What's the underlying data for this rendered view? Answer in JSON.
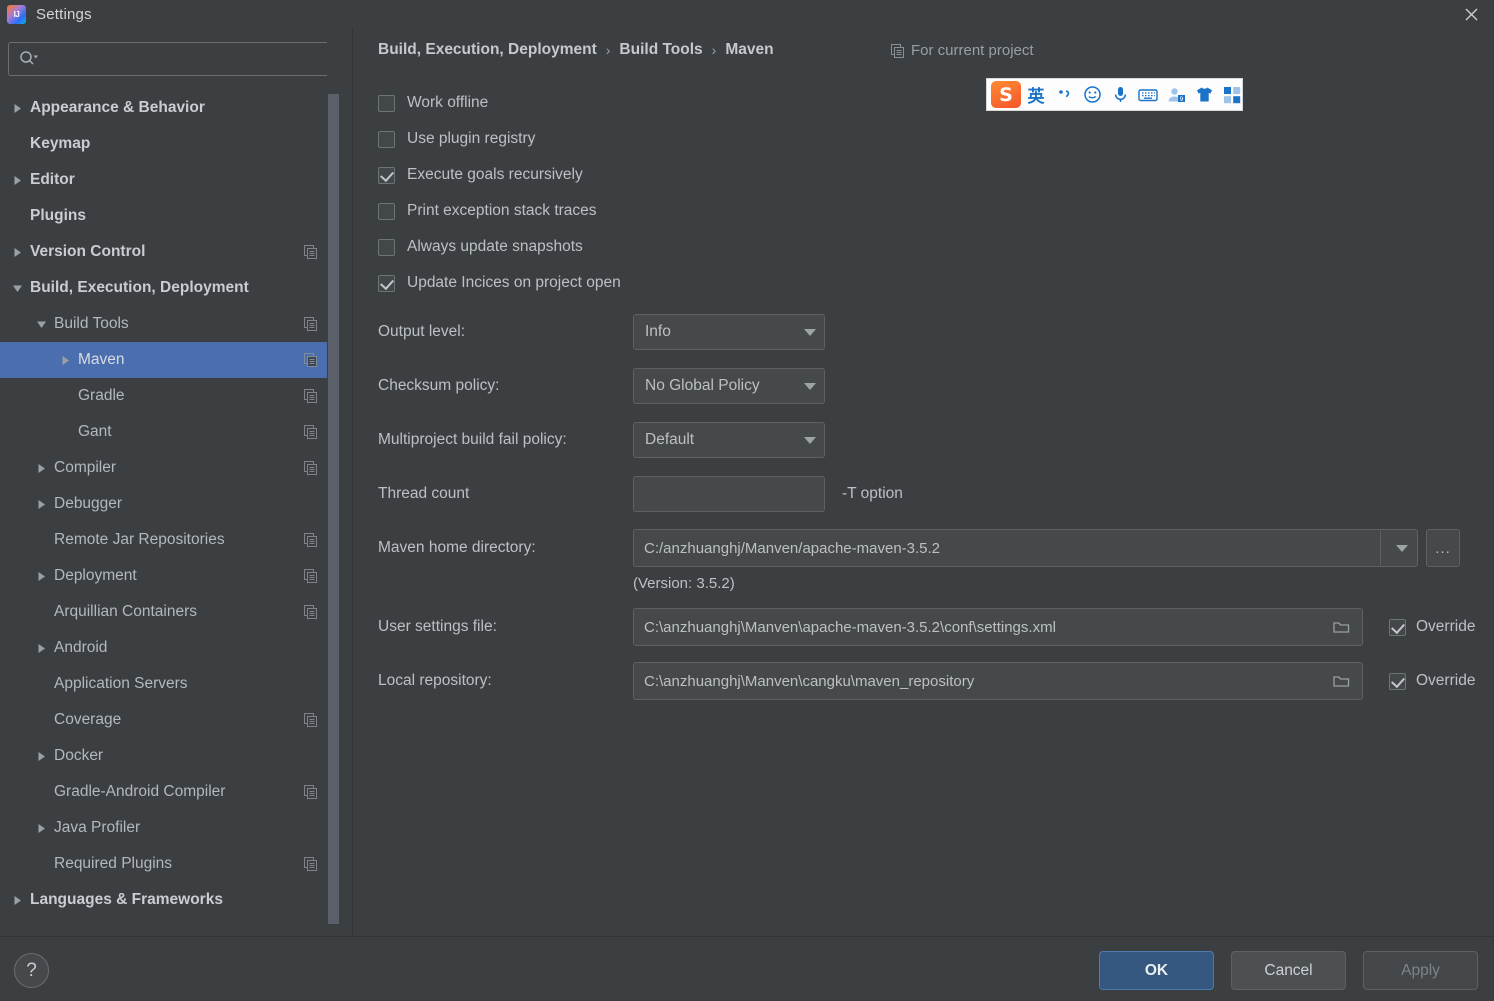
{
  "window": {
    "title": "Settings",
    "app_icon": "intellij-idea-logo",
    "close_icon": "close-icon"
  },
  "sidebar": {
    "search": {
      "placeholder": "",
      "value": "",
      "icon": "search-icon"
    },
    "items": [
      {
        "label": "Appearance & Behavior",
        "indent": 0,
        "arrow": "collapsed",
        "bold": true,
        "copy_icon": false
      },
      {
        "label": "Keymap",
        "indent": 0,
        "arrow": "none",
        "bold": true,
        "copy_icon": false
      },
      {
        "label": "Editor",
        "indent": 0,
        "arrow": "collapsed",
        "bold": true,
        "copy_icon": false
      },
      {
        "label": "Plugins",
        "indent": 0,
        "arrow": "none",
        "bold": true,
        "copy_icon": false
      },
      {
        "label": "Version Control",
        "indent": 0,
        "arrow": "collapsed",
        "bold": true,
        "copy_icon": true
      },
      {
        "label": "Build, Execution, Deployment",
        "indent": 0,
        "arrow": "expanded",
        "bold": true,
        "copy_icon": false
      },
      {
        "label": "Build Tools",
        "indent": 1,
        "arrow": "expanded",
        "bold": false,
        "copy_icon": true
      },
      {
        "label": "Maven",
        "indent": 2,
        "arrow": "collapsed",
        "bold": false,
        "copy_icon": true,
        "selected": true
      },
      {
        "label": "Gradle",
        "indent": 2,
        "arrow": "none",
        "bold": false,
        "copy_icon": true
      },
      {
        "label": "Gant",
        "indent": 2,
        "arrow": "none",
        "bold": false,
        "copy_icon": true
      },
      {
        "label": "Compiler",
        "indent": 1,
        "arrow": "collapsed",
        "bold": false,
        "copy_icon": true
      },
      {
        "label": "Debugger",
        "indent": 1,
        "arrow": "collapsed",
        "bold": false,
        "copy_icon": false
      },
      {
        "label": "Remote Jar Repositories",
        "indent": 1,
        "arrow": "none",
        "bold": false,
        "copy_icon": true
      },
      {
        "label": "Deployment",
        "indent": 1,
        "arrow": "collapsed",
        "bold": false,
        "copy_icon": true
      },
      {
        "label": "Arquillian Containers",
        "indent": 1,
        "arrow": "none",
        "bold": false,
        "copy_icon": true
      },
      {
        "label": "Android",
        "indent": 1,
        "arrow": "collapsed",
        "bold": false,
        "copy_icon": false
      },
      {
        "label": "Application Servers",
        "indent": 1,
        "arrow": "none",
        "bold": false,
        "copy_icon": false
      },
      {
        "label": "Coverage",
        "indent": 1,
        "arrow": "none",
        "bold": false,
        "copy_icon": true
      },
      {
        "label": "Docker",
        "indent": 1,
        "arrow": "collapsed",
        "bold": false,
        "copy_icon": false
      },
      {
        "label": "Gradle-Android Compiler",
        "indent": 1,
        "arrow": "none",
        "bold": false,
        "copy_icon": true
      },
      {
        "label": "Java Profiler",
        "indent": 1,
        "arrow": "collapsed",
        "bold": false,
        "copy_icon": false
      },
      {
        "label": "Required Plugins",
        "indent": 1,
        "arrow": "none",
        "bold": false,
        "copy_icon": true
      },
      {
        "label": "Languages & Frameworks",
        "indent": 0,
        "arrow": "collapsed",
        "bold": true,
        "copy_icon": false
      }
    ]
  },
  "main": {
    "breadcrumb": {
      "part1": "Build, Execution, Deployment",
      "part2": "Build Tools",
      "part3": "Maven",
      "separator": "›"
    },
    "scope_note": {
      "label": "For current project",
      "icon": "copy-icon"
    },
    "checkboxes": [
      {
        "label": "Work offline",
        "checked": false
      },
      {
        "label": "Use plugin registry",
        "checked": false
      },
      {
        "label": "Execute goals recursively",
        "checked": true
      },
      {
        "label": "Print exception stack traces",
        "checked": false
      },
      {
        "label": "Always update snapshots",
        "checked": false
      },
      {
        "label": "Update Incices on project open",
        "checked": true
      }
    ],
    "output_level": {
      "label": "Output level:",
      "value": "Info"
    },
    "checksum_policy": {
      "label": "Checksum policy:",
      "value": "No Global Policy"
    },
    "multiproject": {
      "label": "Multiproject build fail policy:",
      "value": "Default"
    },
    "thread_count": {
      "label": "Thread count",
      "value": "",
      "hint": "-T option"
    },
    "maven_home": {
      "label": "Maven home directory:",
      "value": "C:/anzhuanghj/Manven/apache-maven-3.5.2",
      "browse_label": "...",
      "version_note": "(Version: 3.5.2)"
    },
    "user_settings": {
      "label": "User settings file:",
      "value": "C:\\anzhuanghj\\Manven\\apache-maven-3.5.2\\conf\\settings.xml",
      "override_label": "Override",
      "override_checked": true
    },
    "local_repository": {
      "label": "Local repository:",
      "value": "C:\\anzhuanghj\\Manven\\cangku\\maven_repository",
      "override_label": "Override",
      "override_checked": true
    }
  },
  "ime_toolbar": {
    "logo": "sogou-logo",
    "logo_text": "S",
    "mode_label": "英",
    "items": [
      "punctuation-icon",
      "emoji-icon",
      "microphone-icon",
      "keyboard-icon",
      "user-icon",
      "skin-shirt-icon",
      "apps-grid-icon"
    ]
  },
  "footer": {
    "help_label": "?",
    "ok_label": "OK",
    "cancel_label": "Cancel",
    "apply_label": "Apply",
    "apply_disabled": true
  },
  "colors": {
    "background": "#3c3f41",
    "selection": "#4b6eaf",
    "primary_button": "#365880",
    "text": "#bcc0c4",
    "ime_accent": "#1a73c7",
    "ime_logo": "#f4552a"
  }
}
